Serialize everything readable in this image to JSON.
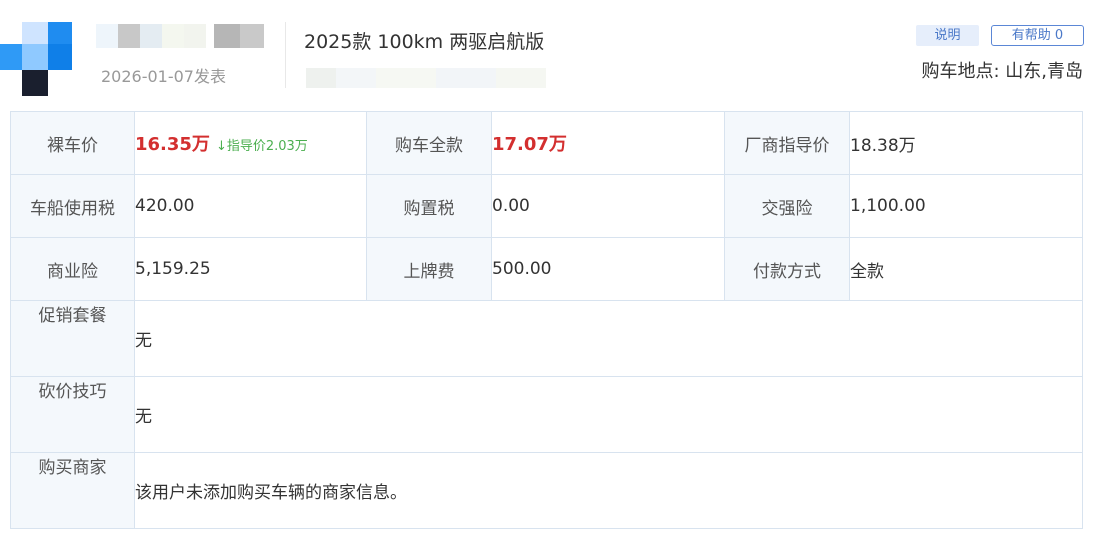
{
  "header": {
    "post_date": "2026-01-07发表",
    "car_model": "2025款 100km 两驱启航版",
    "explain_button": "说明",
    "helpful_button": "有帮助 0",
    "location": "购车地点: 山东,青岛"
  },
  "prices": {
    "bare_car_label": "裸车价",
    "bare_car_value": "16.35万",
    "bare_car_drop": "↓指导价2.03万",
    "total_label": "购车全款",
    "total_value": "17.07万",
    "msrp_label": "厂商指导价",
    "msrp_value": "18.38万",
    "vessel_tax_label": "车船使用税",
    "vessel_tax_value": "420.00",
    "purchase_tax_label": "购置税",
    "purchase_tax_value": "0.00",
    "compulsory_ins_label": "交强险",
    "compulsory_ins_value": "1,100.00",
    "commercial_ins_label": "商业险",
    "commercial_ins_value": "5,159.25",
    "plate_fee_label": "上牌费",
    "plate_fee_value": "500.00",
    "payment_label": "付款方式",
    "payment_value": "全款"
  },
  "details": {
    "promo_label": "促销套餐",
    "promo_value": "无",
    "bargain_label": "砍价技巧",
    "bargain_value": "无",
    "dealer_label": "购买商家",
    "dealer_value": "该用户未添加购买车辆的商家信息。"
  },
  "colors": {
    "highlight_price": "#d32f2f",
    "price_drop": "#4caf50",
    "label_bg": "#f4f8fc",
    "border": "#d8e3ef",
    "accent_blue": "#4a78c8"
  }
}
